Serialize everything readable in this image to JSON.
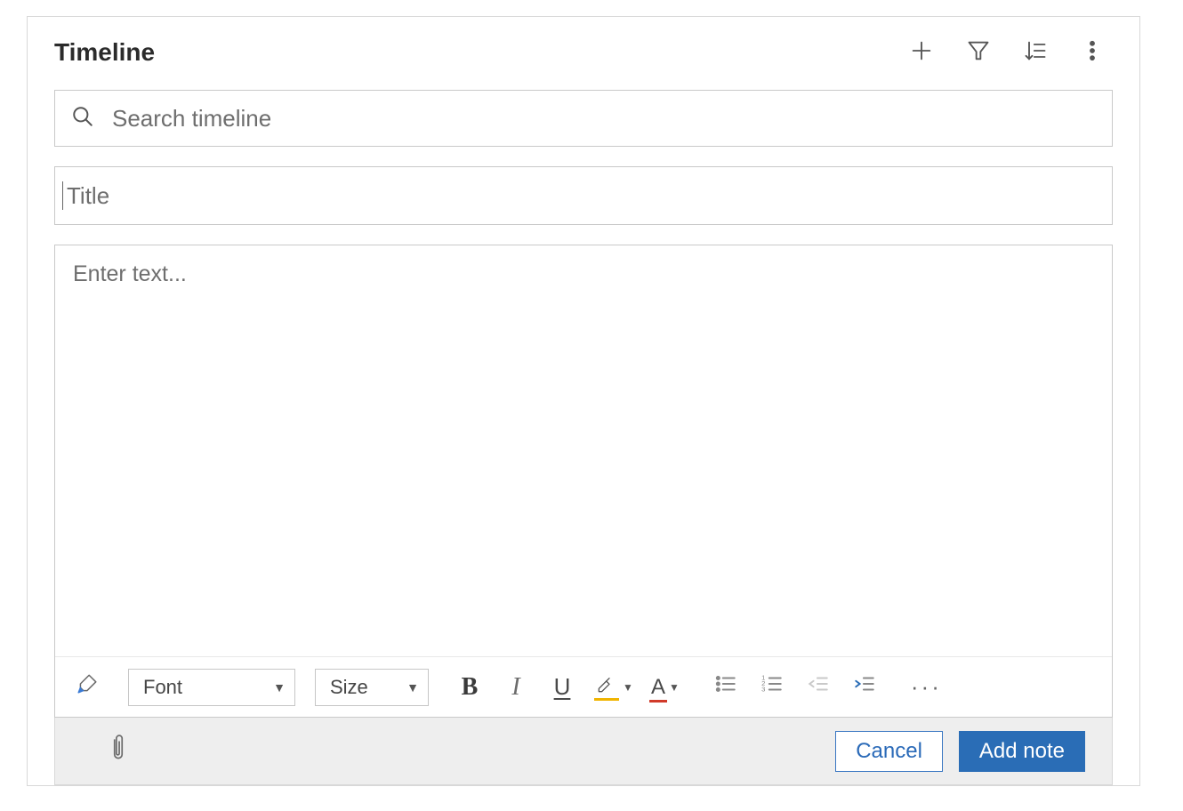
{
  "header": {
    "title": "Timeline"
  },
  "search": {
    "placeholder": "Search timeline",
    "value": ""
  },
  "note": {
    "title_placeholder": "Title",
    "title_value": "",
    "body_placeholder": "Enter text...",
    "body_value": ""
  },
  "toolbar": {
    "font_label": "Font",
    "size_label": "Size",
    "bold_glyph": "B",
    "italic_glyph": "I",
    "underline_glyph": "U",
    "fontcolor_glyph": "A",
    "more_glyph": "···"
  },
  "footer": {
    "cancel_label": "Cancel",
    "addnote_label": "Add note"
  }
}
